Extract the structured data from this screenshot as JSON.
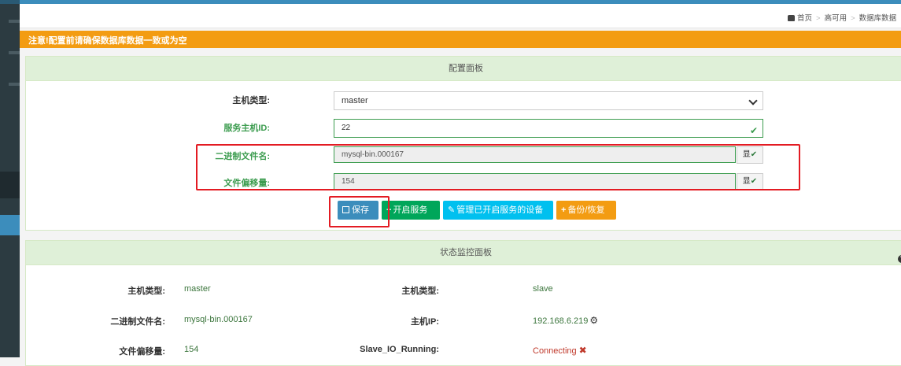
{
  "breadcrumb": {
    "home": "首页",
    "item2": "高可用",
    "item3": "数据库数据"
  },
  "alert": {
    "text": "注意!配置前请确保数据库数据一致或为空"
  },
  "config_panel": {
    "title": "配置面板",
    "host_type_label": "主机类型:",
    "host_type_value": "master",
    "server_id_label": "服务主机ID:",
    "server_id_value": "22",
    "binlog_label": "二进制文件名:",
    "binlog_value": "mysql-bin.000167",
    "offset_label": "文件偏移量:",
    "offset_value": "154",
    "addon_label": "显",
    "buttons": {
      "save": "保存",
      "start": "开启服务",
      "manage": "管理已开启服务的设备",
      "backup": "备份/恢复"
    }
  },
  "monitor_panel": {
    "title": "状态监控面板",
    "help": "帮",
    "left": [
      {
        "label": "主机类型:",
        "value": "master"
      },
      {
        "label": "二进制文件名:",
        "value": "mysql-bin.000167"
      },
      {
        "label": "文件偏移量:",
        "value": "154"
      }
    ],
    "right": [
      {
        "label": "主机类型:",
        "value": "slave"
      },
      {
        "label": "主机IP:",
        "value": "192.168.6.219"
      },
      {
        "label": "Slave_IO_Running:",
        "value": "Connecting"
      }
    ]
  },
  "colors": {
    "primary": "#3c8dbc",
    "success": "#00a65a",
    "info": "#00c0ef",
    "warning": "#f39c12",
    "danger": "#e31b23"
  },
  "icons": [
    "home-icon",
    "check-icon",
    "save-icon",
    "plus-icon",
    "edit-icon",
    "gear-icon",
    "x-icon",
    "help-icon",
    "chevron-down-icon"
  ]
}
